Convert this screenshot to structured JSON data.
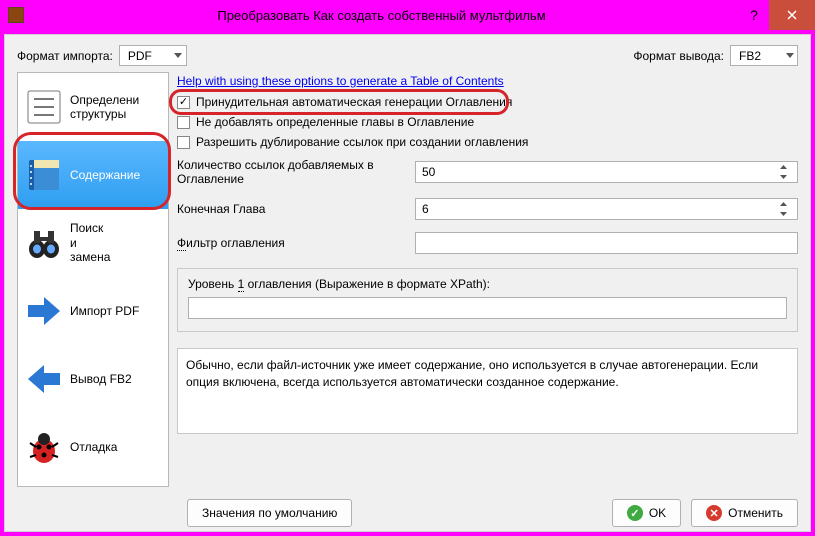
{
  "titlebar": {
    "title": "Преобразовать Как создать собственный мультфильм"
  },
  "topbar": {
    "import_label": "Формат импорта:",
    "import_value": "PDF",
    "output_label": "Формат вывода:",
    "output_value": "FB2"
  },
  "sidebar": {
    "items": [
      {
        "label": "Определени​структуры"
      },
      {
        "label": "Содержание"
      },
      {
        "label": "Поиск\nи\nзамена"
      },
      {
        "label": "Импорт PDF"
      },
      {
        "label": "Вывод FB2"
      },
      {
        "label": "Отладка"
      }
    ]
  },
  "main": {
    "help_link": "Help with using these options to generate a Table of Contents",
    "opt1": "Принудительная автоматическая генерации Оглавления",
    "opt2": "Не добавлять определенные главы в Оглавление",
    "opt3": "Разрешить дублирование ссылок при создании оглавления",
    "links_label": "Количество ссылок добавляемых в Оглавление",
    "links_value": "50",
    "end_chapter_label": "Конечная Глава",
    "end_chapter_value": "6",
    "filter_label_pre": "Ф",
    "filter_label_rest": "ильтр оглавления",
    "group_label_pre": "Уровень ",
    "group_label_num": "1",
    "group_label_rest": " оглавления (Выражение в формате XPath):",
    "description": "Обычно, если файл-источник уже имеет содержание, оно используется в случае автогенерации. Если опция включена, всегда используется автоматически созданное содержание."
  },
  "footer": {
    "defaults": "Значения по умолчанию",
    "ok": "OK",
    "cancel": "Отменить"
  }
}
